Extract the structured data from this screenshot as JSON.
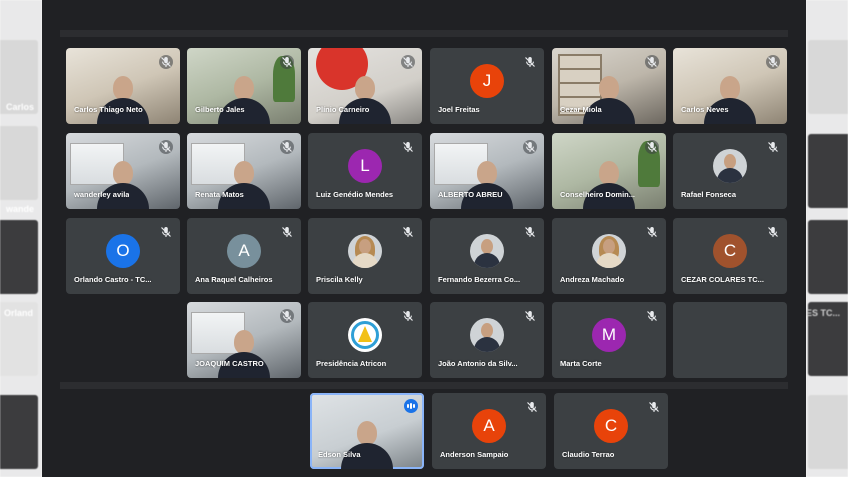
{
  "meeting": {
    "grid": [
      {
        "name": "Carlos Thiago Neto",
        "type": "video",
        "theme": "warm"
      },
      {
        "name": "Gilberto Jales",
        "type": "video",
        "theme": "green"
      },
      {
        "name": "Plínio Carneiro",
        "type": "video",
        "theme": "red"
      },
      {
        "name": "Joel Freitas",
        "type": "avatar",
        "initial": "J",
        "color": "#e8430a"
      },
      {
        "name": "Cezar Miola",
        "type": "video",
        "theme": "shelf"
      },
      {
        "name": "Carlos Neves",
        "type": "video",
        "theme": "warm"
      },
      {
        "name": "wanderley avila",
        "type": "video",
        "theme": "blue"
      },
      {
        "name": "Renata Matos",
        "type": "video",
        "theme": "blue"
      },
      {
        "name": "Luiz Genédio Mendes",
        "type": "avatar",
        "initial": "L",
        "color": "#9c27b0"
      },
      {
        "name": "ALBERTO ABREU",
        "type": "video",
        "theme": "blue"
      },
      {
        "name": "Conselheiro Domin...",
        "type": "video",
        "theme": "green"
      },
      {
        "name": "Rafael Fonseca",
        "type": "photo",
        "photo": "male"
      },
      {
        "name": "Orlando Castro - TC...",
        "type": "avatar",
        "initial": "O",
        "color": "#1a73e8"
      },
      {
        "name": "Ana Raquel Calheiros",
        "type": "avatar",
        "initial": "A",
        "color": "#78909c"
      },
      {
        "name": "Priscila Kelly",
        "type": "photo",
        "photo": "female"
      },
      {
        "name": "Fernando Bezerra Co...",
        "type": "photo",
        "photo": "male"
      },
      {
        "name": "Andreza Machado",
        "type": "photo",
        "photo": "female"
      },
      {
        "name": "CEZAR COLARES TC...",
        "type": "avatar",
        "initial": "C",
        "color": "#a0522d"
      },
      {
        "name": "",
        "type": "empty"
      },
      {
        "name": "JOAQUIM CASTRO",
        "type": "video",
        "theme": "blue"
      },
      {
        "name": "Presidência Atricon",
        "type": "photo",
        "photo": "logo"
      },
      {
        "name": "João Antonio da Silv...",
        "type": "photo",
        "photo": "male"
      },
      {
        "name": "Marta Corte",
        "type": "avatar",
        "initial": "M",
        "color": "#9c27b0"
      },
      {
        "name": "",
        "type": "empty"
      }
    ],
    "bottom": [
      {
        "name": "Edson Silva",
        "type": "video",
        "theme": "speaker",
        "speaking": true
      },
      {
        "name": "Anderson Sampaio",
        "type": "avatar",
        "initial": "A",
        "color": "#e8430a"
      },
      {
        "name": "Claudio Terrao",
        "type": "avatar",
        "initial": "C",
        "color": "#e8430a"
      }
    ],
    "side_left": [
      "Carlos",
      "wande",
      "Orland"
    ],
    "side_right": [
      "ES TC..."
    ]
  }
}
